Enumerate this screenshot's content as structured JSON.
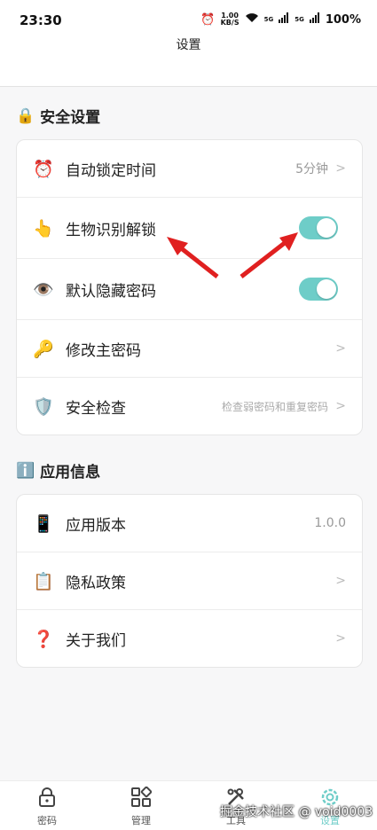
{
  "status": {
    "time": "23:30",
    "speed_value": "1.00",
    "speed_unit": "KB/S",
    "net1": "5G",
    "net2": "5G",
    "battery": "100%"
  },
  "header": {
    "title": "设置"
  },
  "security": {
    "title": "安全设置",
    "icon": "lock-icon",
    "rows": [
      {
        "icon": "⏰",
        "label": "自动锁定时间",
        "value": "5分钟",
        "chevron": ">"
      },
      {
        "icon": "👆",
        "label": "生物识别解锁",
        "toggle": true
      },
      {
        "icon": "👁️",
        "label": "默认隐藏密码",
        "toggle": true
      },
      {
        "icon": "🔑",
        "label": "修改主密码",
        "chevron": ">"
      },
      {
        "icon": "🛡️",
        "label": "安全检查",
        "value": "检查弱密码和重复密码",
        "chevron": ">"
      }
    ]
  },
  "appinfo": {
    "title": "应用信息",
    "icon": "info-icon",
    "rows": [
      {
        "icon": "📱",
        "label": "应用版本",
        "value": "1.0.0"
      },
      {
        "icon": "📋",
        "label": "隐私政策",
        "chevron": ">"
      },
      {
        "icon": "❓",
        "label": "关于我们",
        "chevron": ">"
      }
    ]
  },
  "tabs": [
    {
      "label": "密码",
      "icon": "lock-icon"
    },
    {
      "label": "管理",
      "icon": "grid-icon"
    },
    {
      "label": "工具",
      "icon": "tools-icon"
    },
    {
      "label": "设置",
      "icon": "gear-icon",
      "active": true
    }
  ],
  "watermark": "掘金技术社区 @ void0003",
  "colors": {
    "accent": "#6ecdc8",
    "arrow": "#e02020"
  }
}
